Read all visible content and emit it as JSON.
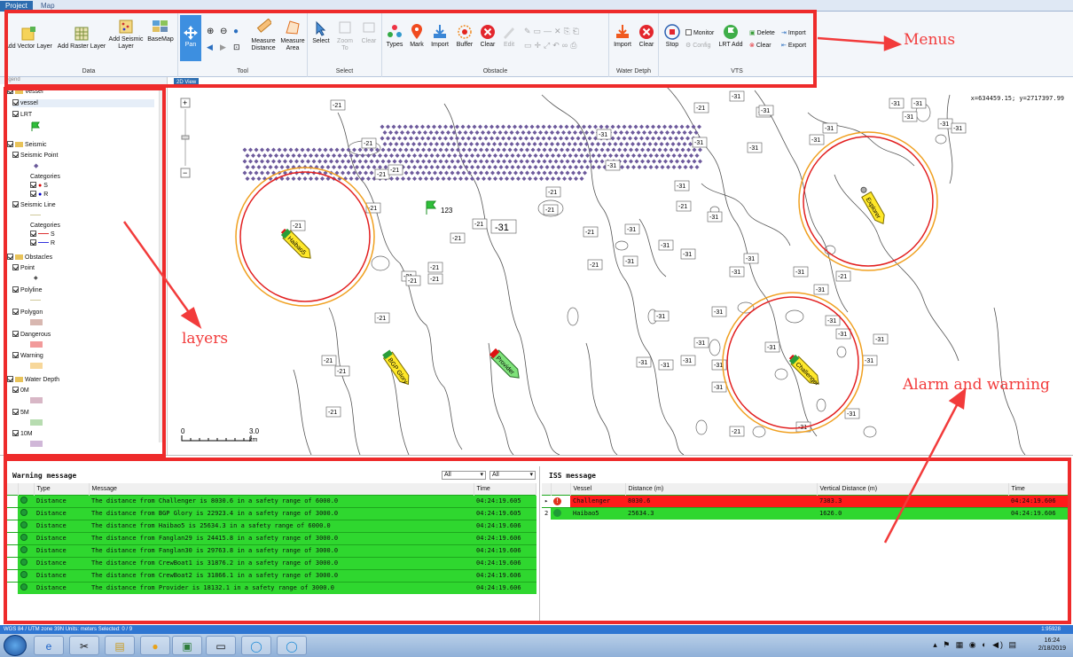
{
  "tabs": [
    "Project",
    "Map"
  ],
  "ribbon": {
    "groups": {
      "data": "Data",
      "tool": "Tool",
      "select": "Select",
      "obstacle": "Obstacle",
      "water_depth": "Water Detph",
      "vts": "VTS"
    },
    "buttons": {
      "add_vector_layer": "Add Vector Layer",
      "add_raster_layer": "Add Raster Layer",
      "add_seismic_layer": "Add Seismic Layer",
      "basemap": "BaseMap",
      "pan": "Pan",
      "measure_distance": "Measure Distance",
      "measure_area": "Measure Area",
      "select": "Select",
      "zoom_to": "Zoom To",
      "clear_select": "Clear",
      "types": "Types",
      "mark": "Mark",
      "import_obstacle": "Import",
      "buffer": "Buffer",
      "clear_obstacle": "Clear",
      "edit": "Edit",
      "import_depth": "Import",
      "clear_depth": "Clear",
      "stop": "Stop",
      "monitor": "Monitor",
      "config": "Config",
      "lrt_add": "LRT Add",
      "delete": "Delete",
      "clear_vts": "Clear",
      "import_vts": "Import",
      "export_vts": "Export"
    }
  },
  "legend": {
    "header": "egend",
    "items": {
      "vessel_group": "Vessel",
      "vessel": "vessel",
      "lrt": "LRT",
      "seismic_group": "Seismic",
      "seismic_point": "Seismic Point",
      "categories1": "Categories",
      "cat_s1": "S",
      "cat_r1": "R",
      "seismic_line": "Seismic Line",
      "categories2": "Categories",
      "cat_s2": "S",
      "cat_r2": "R",
      "obstacles_group": "Obstacles",
      "point": "Point",
      "polyline": "Polyline",
      "polygon": "Polygon",
      "dangerous": "Dangerous",
      "warning": "Warning",
      "water_depth_group": "Water Depth",
      "d0": "0M",
      "d5": "5M",
      "d10": "10M"
    },
    "colors": {
      "polygon": "#d8b7b0",
      "dangerous": "#f29a9a",
      "warning": "#f7d79a",
      "d0": "#d8b7c6",
      "d5": "#b7dcb0",
      "d10": "#d0b7d8"
    }
  },
  "map": {
    "tab": "2D View",
    "coords": "x=634459.15; y=2717397.99",
    "scale_start": "0",
    "scale_end": "3.0",
    "scale_unit": "km",
    "flag_label": "123",
    "depth_labels": [
      "-21",
      "-31"
    ],
    "vessels": [
      "Haibao5",
      "BGP Glory",
      "Provider",
      "Explorer",
      "Challenger"
    ]
  },
  "warning_pane": {
    "title": "Warning message",
    "filter1": "All",
    "filter2": "All",
    "columns": [
      "Type",
      "Message",
      "Time"
    ],
    "rows": [
      {
        "type": "Distance",
        "message": "The distance from Challenger is 8030.6 in a safety range of 6000.0",
        "time": "04:24:19.605"
      },
      {
        "type": "Distance",
        "message": "The distance from BGP Glory is 22923.4 in a safety range of 3000.0",
        "time": "04:24:19.605"
      },
      {
        "type": "Distance",
        "message": "The distance from Haibao5 is 25634.3 in a safety range of 6000.0",
        "time": "04:24:19.606"
      },
      {
        "type": "Distance",
        "message": "The distance from Fanglan29 is 24415.8 in a safety range of 3000.0",
        "time": "04:24:19.606"
      },
      {
        "type": "Distance",
        "message": "The distance from Fanglan30 is 29763.8 in a safety range of 3000.0",
        "time": "04:24:19.606"
      },
      {
        "type": "Distance",
        "message": "The distance from CrewBoat1 is 31876.2 in a safety range of 3000.0",
        "time": "04:24:19.606"
      },
      {
        "type": "Distance",
        "message": "The distance from CrewBoat2 is 31866.1 in a safety range of 3000.0",
        "time": "04:24:19.606"
      },
      {
        "type": "Distance",
        "message": "The distance from Provider is 18132.1 in a safety range of 3000.0",
        "time": "04:24:19.606"
      }
    ]
  },
  "iss_pane": {
    "title": "ISS message",
    "columns": [
      "Vessel",
      "Distance (m)",
      "Vertical Distance (m)",
      "Time"
    ],
    "rows": [
      {
        "num": "1",
        "vessel": "Challenger",
        "distance": "8030.6",
        "vdistance": "7383.3",
        "time": "04:24:19.606",
        "status": "alarm"
      },
      {
        "num": "2",
        "vessel": "Haibao5",
        "distance": "25634.3",
        "vdistance": "1626.0",
        "time": "04:24:19.606",
        "status": "ok"
      }
    ]
  },
  "status_bar": {
    "left": "WGS 84 / UTM zone 39N   Units: meters   Selected: 0 / 9",
    "right": "1:95928"
  },
  "clock": {
    "time": "16:24",
    "date": "2/18/2019"
  },
  "annotations": {
    "menus": "Menus",
    "layers": "layers",
    "alarm": "Alarm and warning"
  }
}
